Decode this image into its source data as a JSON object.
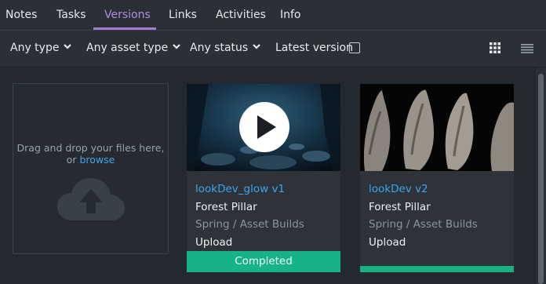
{
  "tabs": [
    {
      "label": "Notes"
    },
    {
      "label": "Tasks"
    },
    {
      "label": "Versions"
    },
    {
      "label": "Links"
    },
    {
      "label": "Activities"
    },
    {
      "label": "Info"
    }
  ],
  "filters": {
    "type_label": "Any type",
    "asset_type_label": "Any asset type",
    "status_label": "Any status",
    "latest_version_label": "Latest version"
  },
  "dropzone": {
    "text": "Drag and drop your files here, or",
    "browse_label": "browse"
  },
  "cards": [
    {
      "title": "lookDev_glow v1",
      "entity": "Forest Pillar",
      "path": "Spring / Asset Builds",
      "type": "Upload",
      "status": "Completed",
      "status_color": "#16b386"
    },
    {
      "title": "lookDev v2",
      "entity": "Forest Pillar",
      "path": "Spring / Asset Builds",
      "type": "Upload",
      "status": "",
      "status_color": "#16b386"
    }
  ],
  "colors": {
    "active_tab": "#b48be0",
    "link": "#3ea4e8",
    "status_completed": "#16b386"
  }
}
